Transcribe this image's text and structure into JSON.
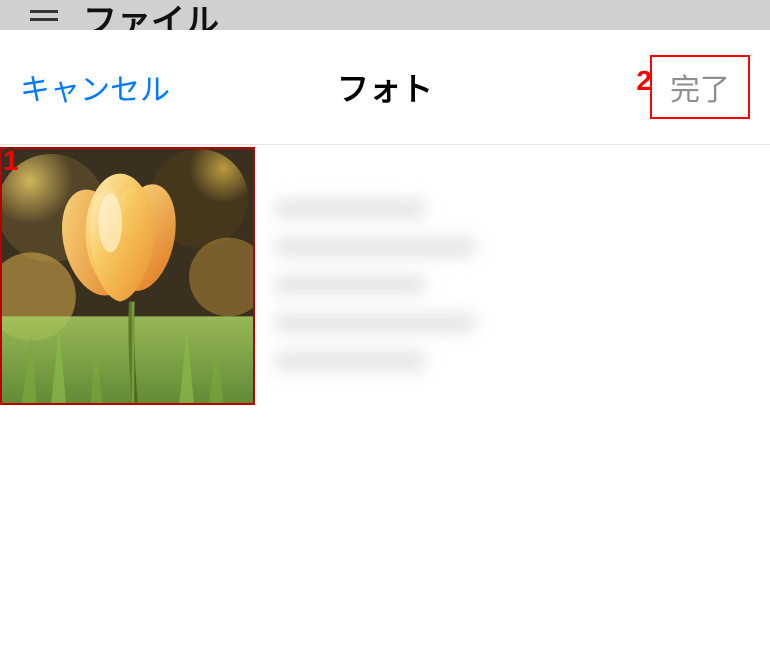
{
  "background": {
    "title_fragment": "ファイル"
  },
  "modal": {
    "cancel_label": "キャンセル",
    "title": "フォト",
    "done_label": "完了"
  },
  "annotations": {
    "step1": "1",
    "step2": "2"
  },
  "photos": [
    {
      "name": "tulip-photo",
      "description": "Orange/yellow tulip close-up with green grass and blurred bokeh background"
    }
  ]
}
